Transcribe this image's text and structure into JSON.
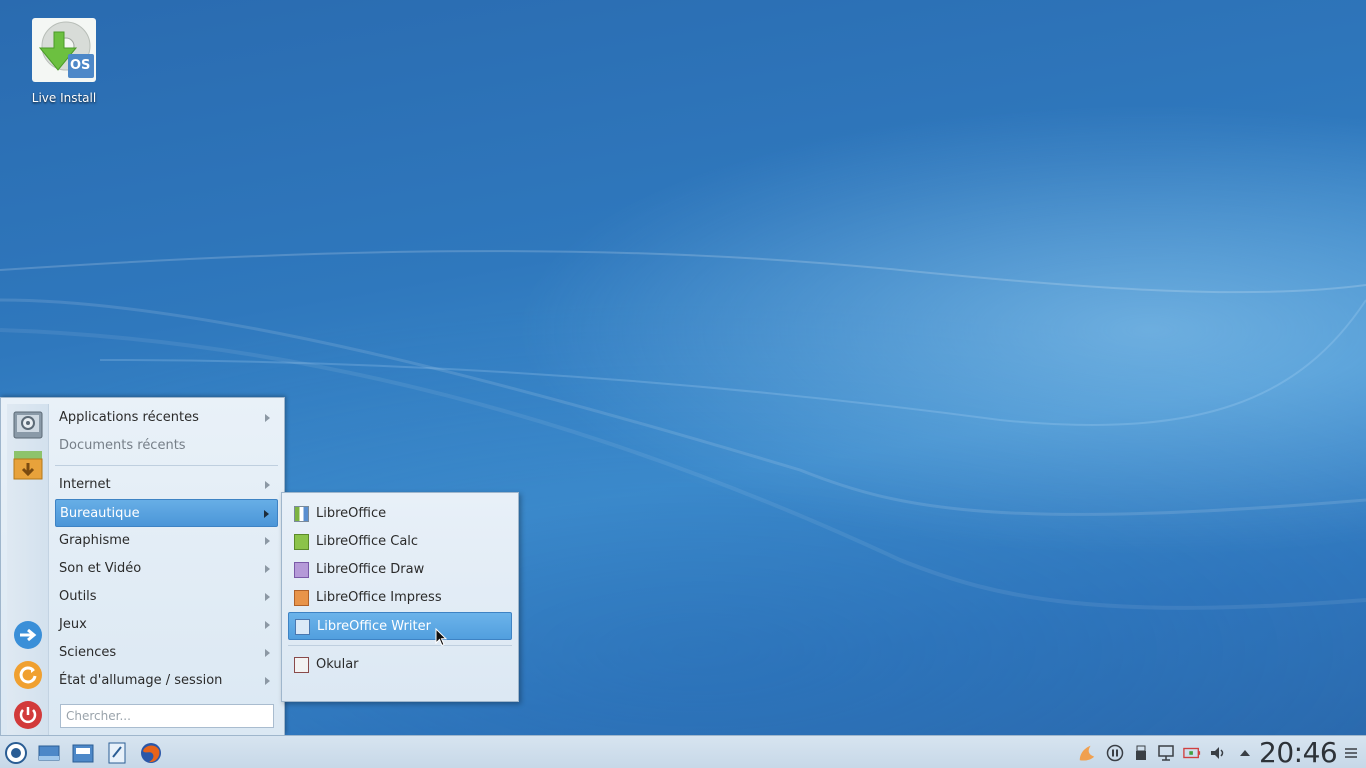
{
  "desktop": {
    "icons": [
      {
        "label": "Live Install",
        "badge": "OS"
      }
    ]
  },
  "launcher": {
    "items": [
      {
        "label": "Applications récentes",
        "has_submenu": true
      },
      {
        "label": "Documents récents",
        "has_submenu": false
      },
      {
        "label": "Internet",
        "has_submenu": true
      },
      {
        "label": "Bureautique",
        "has_submenu": true,
        "active": true
      },
      {
        "label": "Graphisme",
        "has_submenu": true
      },
      {
        "label": "Son et Vidéo",
        "has_submenu": true
      },
      {
        "label": "Outils",
        "has_submenu": true
      },
      {
        "label": "Jeux",
        "has_submenu": true
      },
      {
        "label": "Sciences",
        "has_submenu": true
      },
      {
        "label": "État d'allumage / session",
        "has_submenu": true
      }
    ],
    "search_placeholder": "Chercher...",
    "side_icons": [
      "system-settings-icon",
      "software-center-icon",
      "switch-user-icon",
      "reboot-icon",
      "power-icon"
    ]
  },
  "submenu": {
    "items": [
      {
        "label": "LibreOffice",
        "icon": "libreoffice-icon"
      },
      {
        "label": "LibreOffice Calc",
        "icon": "libreoffice-calc-icon"
      },
      {
        "label": "LibreOffice Draw",
        "icon": "libreoffice-draw-icon"
      },
      {
        "label": "LibreOffice Impress",
        "icon": "libreoffice-impress-icon"
      },
      {
        "label": "LibreOffice Writer",
        "icon": "libreoffice-writer-icon",
        "active": true
      },
      {
        "label": "Okular",
        "icon": "okular-icon"
      }
    ]
  },
  "taskbar": {
    "launchers": [
      "app-launcher-icon",
      "show-desktop-icon",
      "file-manager-icon",
      "text-editor-icon",
      "firefox-icon"
    ],
    "tray": [
      "hand-icon",
      "media-pause-icon",
      "usb-device-icon",
      "network-icon",
      "battery-icon",
      "volume-icon",
      "expand-tray-icon"
    ],
    "clock": "20:46"
  },
  "colors": {
    "accent": "#4b96d8",
    "desktop": "#2f78bd"
  }
}
